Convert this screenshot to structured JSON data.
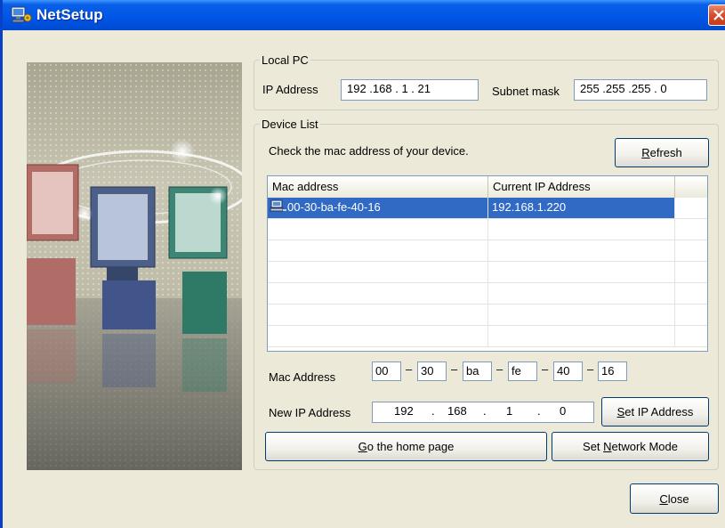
{
  "window": {
    "title": "NetSetup"
  },
  "local_pc": {
    "legend": "Local PC",
    "ip_label": "IP Address",
    "ip_value": "192 .168 .  1  . 21",
    "mask_label": "Subnet mask",
    "mask_value": "255 .255 .255 .  0"
  },
  "device_list": {
    "legend": "Device List",
    "hint": "Check the mac address of your device.",
    "refresh_label": "efresh",
    "refresh_mnemonic": "R",
    "columns": [
      "Mac address",
      "Current IP Address"
    ],
    "rows": [
      {
        "mac": "00-30-ba-fe-40-16",
        "ip": "192.168.1.220",
        "selected": true
      }
    ],
    "mac_label": "Mac Address",
    "mac_parts": [
      "00",
      "30",
      "ba",
      "fe",
      "40",
      "16"
    ],
    "new_ip_label": "New IP Address",
    "new_ip_parts": [
      "192",
      "168",
      "1",
      "0"
    ],
    "set_ip_mnemonic": "S",
    "set_ip_rest": "et IP Address",
    "home_mnemonic": "G",
    "home_rest": "o the home page",
    "mode_pre": "Set ",
    "mode_mnemonic": "N",
    "mode_rest": "etwork Mode"
  },
  "footer": {
    "close_mnemonic": "C",
    "close_rest": "lose"
  },
  "colors": {
    "titlebar": "#0055e5",
    "selection": "#316ac5",
    "dialog": "#ece9d8"
  }
}
